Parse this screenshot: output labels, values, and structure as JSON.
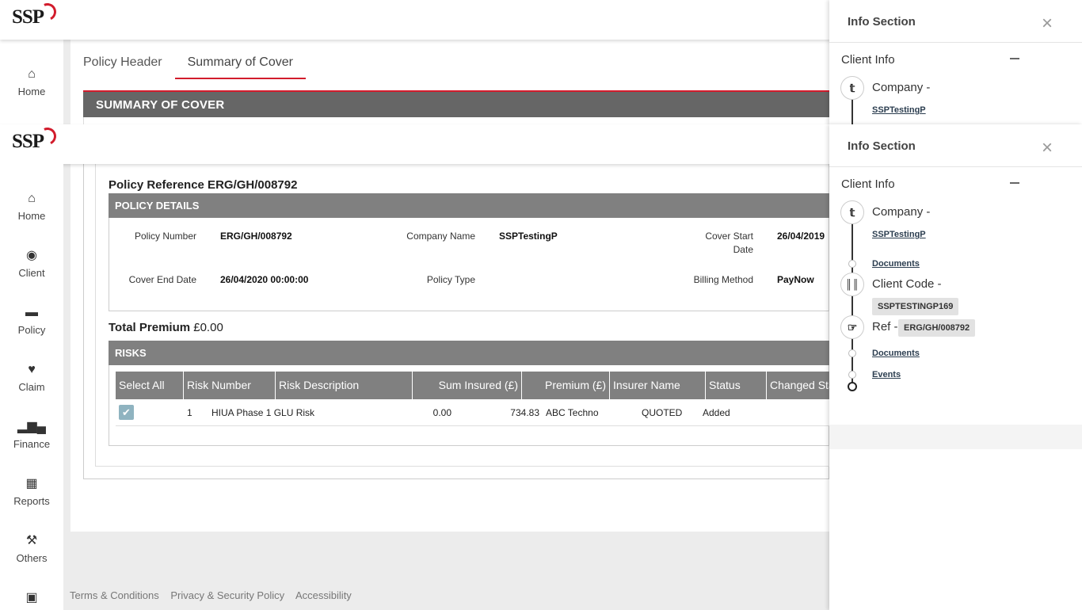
{
  "brand": {
    "logo_text": "SSP",
    "accent": "#d21c2c"
  },
  "tabs": [
    {
      "label": "Policy Header"
    },
    {
      "label": "Summary of Cover",
      "active": true
    }
  ],
  "summary_title": "SUMMARY OF COVER",
  "sidebar": {
    "items": [
      {
        "label": "Home",
        "icon": "home-icon"
      },
      {
        "label": "Client",
        "icon": "users-icon"
      },
      {
        "label": "Policy",
        "icon": "credit-card-icon"
      },
      {
        "label": "Claim",
        "icon": "heart-icon"
      },
      {
        "label": "Finance",
        "icon": "bar-chart-icon"
      },
      {
        "label": "Reports",
        "icon": "grid-icon"
      },
      {
        "label": "Others",
        "icon": "gavel-icon"
      }
    ]
  },
  "policy": {
    "reference": "Policy Reference ERG/GH/008792",
    "details_title": "POLICY DETAILS",
    "fields": {
      "policy_number_label": "Policy Number",
      "policy_number": "ERG/GH/008792",
      "company_name_label": "Company Name",
      "company_name": "SSPTestingP",
      "cover_start_label_1": "Cover Start",
      "cover_start_label_2": "Date",
      "cover_start": "26/04/2019",
      "cover_end_label": "Cover End Date",
      "cover_end": "26/04/2020 00:00:00",
      "policy_type_label": "Policy Type",
      "policy_type": "",
      "billing_method_label": "Billing Method",
      "billing_method": "PayNow"
    },
    "total_premium_label": "Total Premium",
    "total_premium_value": "£0.00"
  },
  "risks": {
    "title": "RISKS",
    "columns": [
      "Select All",
      "Risk Number",
      "Risk Description",
      "Sum Insured (£)",
      "Premium (£)",
      "Insurer Name",
      "Status",
      "Changed Status"
    ],
    "rows": [
      {
        "risk_number": "1",
        "description": "HIUA Phase 1 GLU Risk",
        "sum_insured": "0.00",
        "premium": "734.83",
        "insurer": "ABC Techno",
        "status": "QUOTED",
        "changed_status": "Added",
        "selected": true
      }
    ]
  },
  "footer": {
    "links": [
      "Terms & Conditions",
      "Privacy & Security Policy",
      "Accessibility"
    ]
  },
  "info_panel": {
    "title": "Info Section",
    "client_info_label": "Client Info",
    "company_label": "Company -",
    "company_value": "SSPTestingP",
    "documents_label": "Documents",
    "client_code_label": "Client Code -",
    "client_code_value": "SSPTESTINGP169",
    "ref_label": "Ref -",
    "ref_value": "ERG/GH/008792",
    "documents_label_2": "Documents",
    "events_label": "Events"
  }
}
